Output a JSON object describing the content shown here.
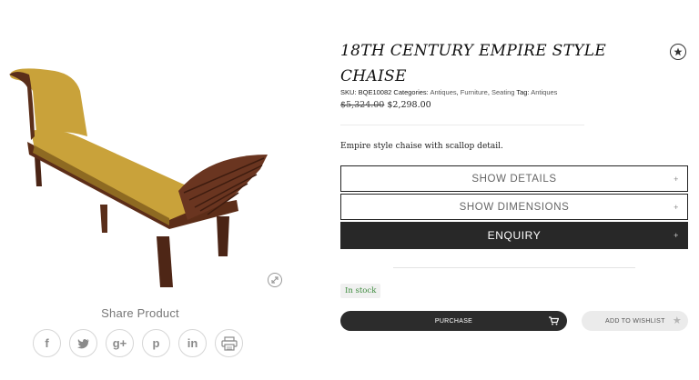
{
  "product": {
    "title_line1": "18TH CENTURY EMPIRE STYLE",
    "title_line2": "CHAISE",
    "sku_label": "SKU:",
    "sku": "BQE10082",
    "categories_label": "Categories:",
    "categories": [
      "Antiques",
      "Furniture",
      "Seating"
    ],
    "tag_label": "Tag:",
    "tag": "Antiques",
    "old_price": "$5,324.00",
    "price": "$2,298.00",
    "description": "Empire style chaise with scallop detail.",
    "stock_status": "In stock"
  },
  "accordion": {
    "details_label": "SHOW DETAILS",
    "dimensions_label": "SHOW DIMENSIONS",
    "enquiry_label": "ENQUIRY",
    "plus_glyph": "+"
  },
  "actions": {
    "purchase_label": "PURCHASE",
    "wishlist_label": "ADD TO WISHLIST"
  },
  "share": {
    "title": "Share Product",
    "icons": [
      "facebook-icon",
      "twitter-icon",
      "google-plus-icon",
      "pinterest-icon",
      "linkedin-icon",
      "print-icon"
    ],
    "facebook_glyph": "f",
    "google_glyph": "g+",
    "pinterest_glyph": "p",
    "linkedin_glyph": "in"
  },
  "colors": {
    "accent_dark": "#282828",
    "stock_green": "#3b8a3b",
    "upholstery": "#c9a23a",
    "wood": "#5a2e1a"
  }
}
